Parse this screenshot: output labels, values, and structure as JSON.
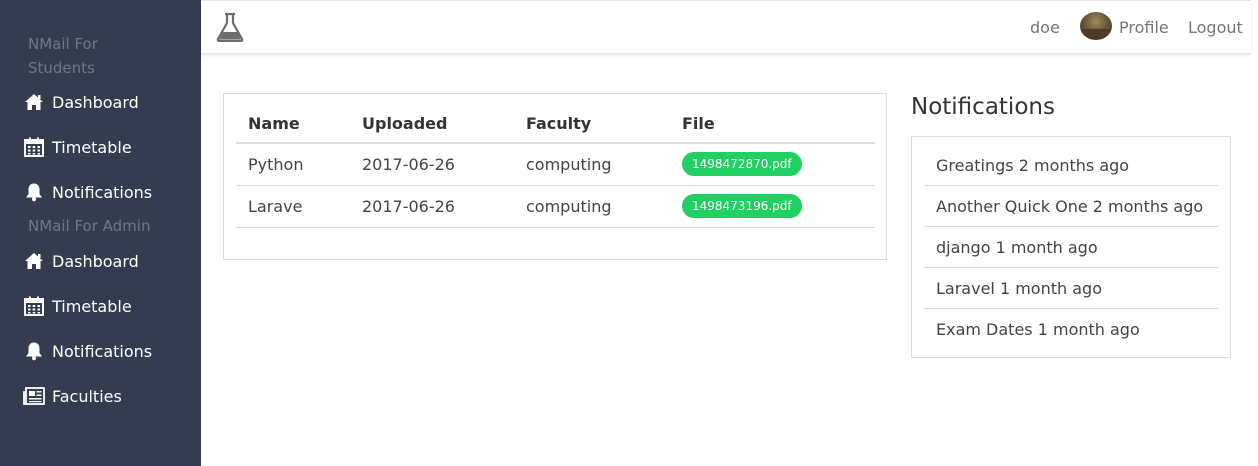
{
  "sidebar": {
    "student_section": "NMail For Students",
    "admin_section": "NMail For Admin",
    "student_items": [
      {
        "label": "Dashboard",
        "icon": "home-icon"
      },
      {
        "label": "Timetable",
        "icon": "calendar-icon"
      },
      {
        "label": "Notifications",
        "icon": "bell-icon"
      }
    ],
    "admin_items": [
      {
        "label": "Dashboard",
        "icon": "home-icon"
      },
      {
        "label": "Timetable",
        "icon": "calendar-icon"
      },
      {
        "label": "Notifications",
        "icon": "bell-icon"
      },
      {
        "label": "Faculties",
        "icon": "newspaper-icon"
      }
    ]
  },
  "topbar": {
    "logo_icon": "flask-icon",
    "username": "doe",
    "profile_label": "Profile",
    "logout_label": "Logout"
  },
  "files_table": {
    "headers": [
      "Name",
      "Uploaded",
      "Faculty",
      "File"
    ],
    "rows": [
      {
        "name": "Python",
        "uploaded": "2017-06-26",
        "faculty": "computing",
        "file": "1498472870.pdf"
      },
      {
        "name": "Larave",
        "uploaded": "2017-06-26",
        "faculty": "computing",
        "file": "1498473196.pdf"
      }
    ]
  },
  "notifications": {
    "title": "Notifications",
    "items": [
      "Greatings 2 months ago",
      "Another Quick One 2 months ago",
      "django 1 month ago",
      "Laravel 1 month ago",
      "Exam Dates 1 month ago"
    ]
  },
  "colors": {
    "sidebar_bg": "#343d4f",
    "pill_green": "#21d062",
    "section_label": "#6f7786"
  }
}
